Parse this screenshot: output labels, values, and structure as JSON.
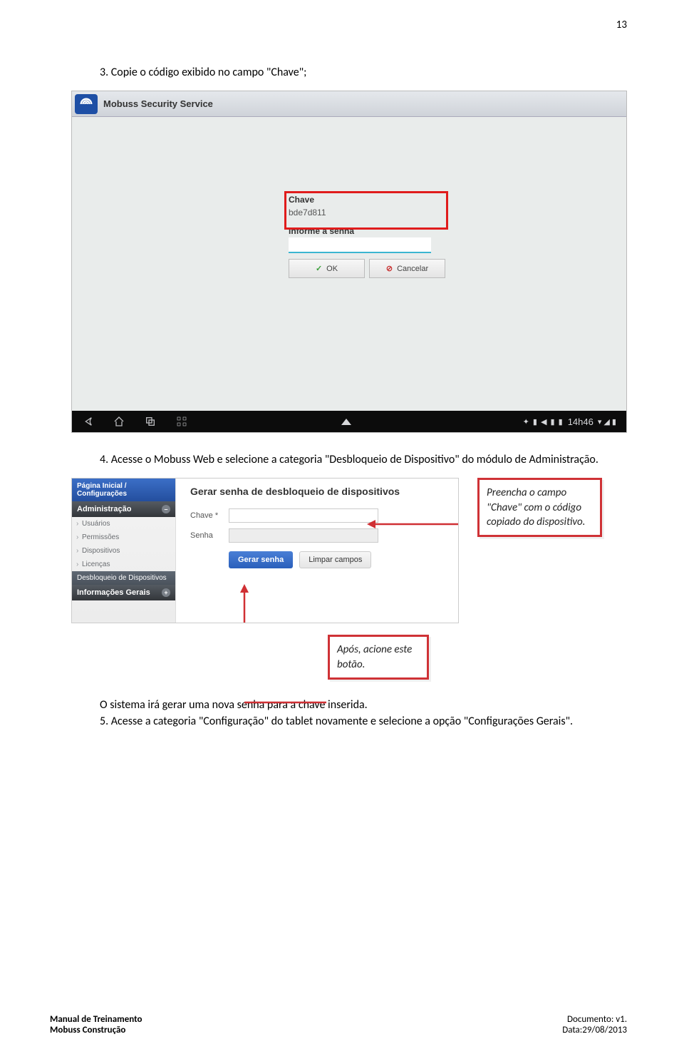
{
  "page_number": "13",
  "paragraphs": {
    "p1": "3. Copie o código exibido no campo \"Chave\";",
    "p2": "4. Acesse o Mobuss Web e selecione a categoria \"Desbloqueio de Dispositivo\" do módulo de Administração.",
    "p4": "O sistema irá gerar uma nova senha para a chave inserida.",
    "p5": "5. Acesse a categoria \"Configuração\" do tablet novamente e selecione a opção \"Configurações Gerais\"."
  },
  "tablet": {
    "app_title": "Mobuss Security Service",
    "chave_label": "Chave",
    "chave_value": "bde7d811",
    "senha_label": "Informe a senha",
    "ok": "OK",
    "cancel": "Cancelar",
    "clock": "14h46"
  },
  "callout1": "Preencha o campo \"Chave\" com o código copiado do dispositivo.",
  "callout2": "Após, acione este botão.",
  "webpanel": {
    "breadcrumb": "Página Inicial / Configurações",
    "section_admin": "Administração",
    "items": [
      "Usuários",
      "Permissões",
      "Dispositivos",
      "Licenças"
    ],
    "active": "Desbloqueio de Dispositivos",
    "section_info": "Informações Gerais",
    "heading": "Gerar senha de desbloqueio de dispositivos",
    "chave_lbl": "Chave *",
    "senha_lbl": "Senha",
    "btn_gerar": "Gerar senha",
    "btn_limpar": "Limpar campos"
  },
  "footer": {
    "line1": "Manual de Treinamento",
    "line2": "Mobuss Construção",
    "doc": "Documento: v1.",
    "date": "Data:29/08/2013"
  }
}
